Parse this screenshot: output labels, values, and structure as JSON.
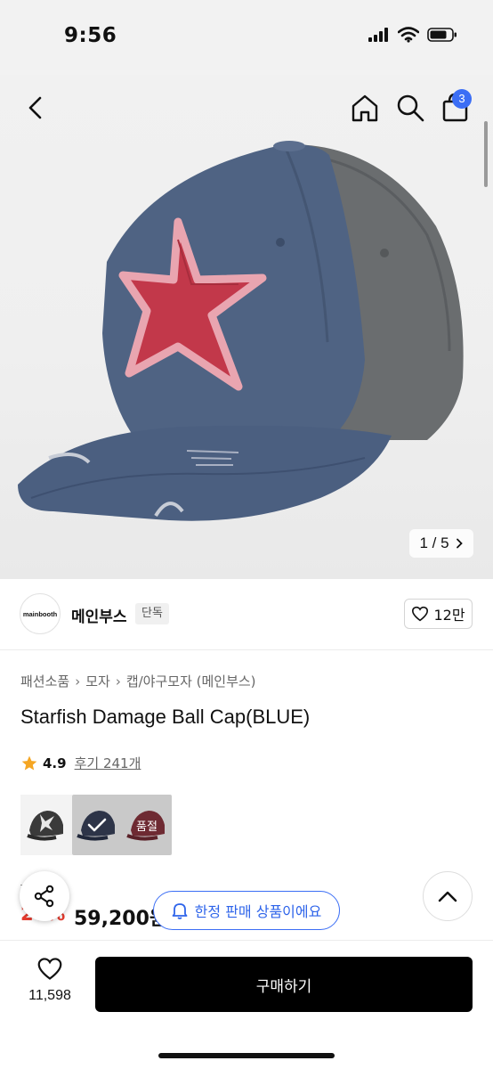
{
  "status_bar": {
    "time": "9:56"
  },
  "header": {
    "cart_count": "3",
    "icons": [
      "back-icon",
      "home-icon",
      "search-icon",
      "shopping-bag-icon"
    ]
  },
  "gallery": {
    "pager": "1 / 5"
  },
  "brand": {
    "logo_text": "mainbooth",
    "name": "메인부스",
    "tag": "단독",
    "likes": "12만"
  },
  "breadcrumb": [
    "패션소품",
    "모자",
    "캡/야구모자 (메인부스)"
  ],
  "product": {
    "title": "Starfish Damage Ball Cap(BLUE)",
    "rating": "4.9",
    "reviews": "후기 241개"
  },
  "options": {
    "soldout_label": "품절"
  },
  "price": {
    "original": "...0원",
    "discount": "20%",
    "sale": "59,200원"
  },
  "badges": {
    "limited": "한정 판매 상품이에요"
  },
  "bottom": {
    "wish_count": "11,598",
    "buy_label": "구매하기"
  },
  "colors": {
    "accent_blue": "#3b6ef5",
    "discount_red": "#e63b2e",
    "buy_black": "#000000",
    "star_orange": "#f5a623"
  }
}
